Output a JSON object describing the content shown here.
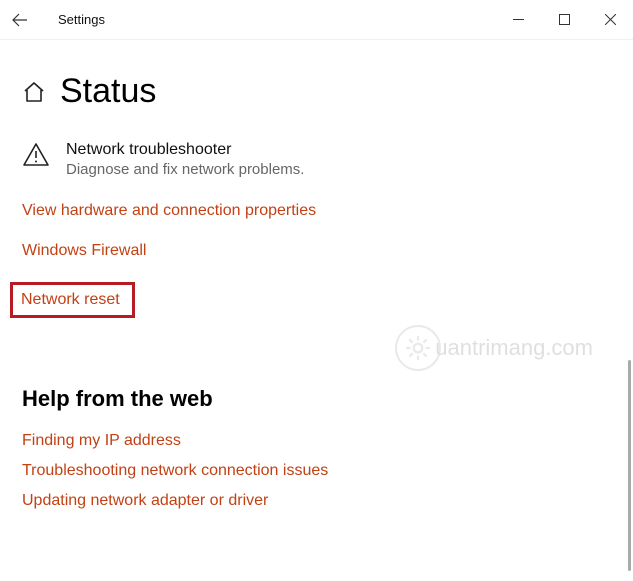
{
  "titlebar": {
    "title": "Settings"
  },
  "page": {
    "title": "Status"
  },
  "troubleshooter": {
    "title": "Network troubleshooter",
    "description": "Diagnose and fix network problems."
  },
  "links": {
    "hardware": "View hardware and connection properties",
    "firewall": "Windows Firewall",
    "reset": "Network reset"
  },
  "help": {
    "heading": "Help from the web",
    "items": [
      "Finding my IP address",
      "Troubleshooting network connection issues",
      "Updating network adapter or driver"
    ]
  },
  "watermark": {
    "text": "uantrimang.com"
  }
}
